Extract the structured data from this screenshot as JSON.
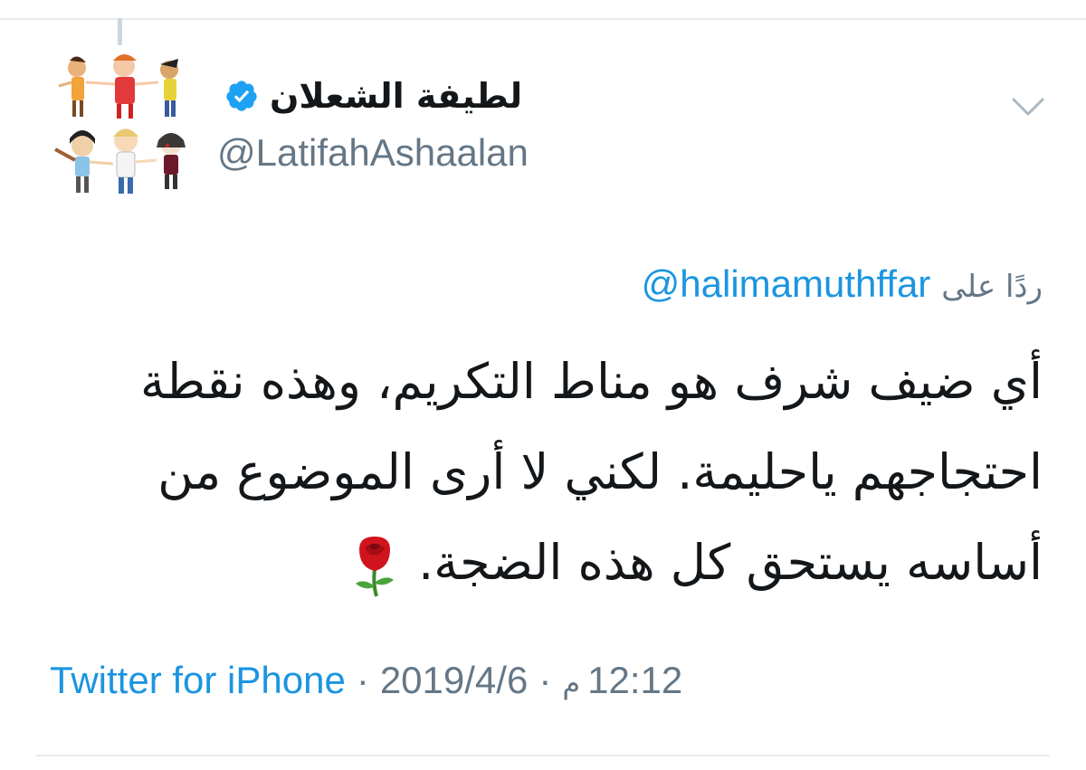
{
  "tweet": {
    "author": {
      "display_name": "لطيفة الشعلان",
      "handle": "@LatifahAshaalan",
      "verified": true
    },
    "reply_prefix": "ردًا على",
    "reply_to": "@halimamuthffar",
    "text": "أي ضيف شرف هو مناط التكريم، وهذه نقطة احتجاجهم ياحليمة. لكني لا أرى الموضوع من أساسه يستحق كل هذه الضجة.",
    "emoji": "rose",
    "time": "12:12",
    "time_suffix": "م",
    "date": "2019/4/6",
    "separator": "·",
    "source": "Twitter for iPhone"
  },
  "icons": {
    "caret": "chevron-down-icon",
    "verified": "verified-badge-icon",
    "rose": "rose-emoji-icon"
  },
  "colors": {
    "link": "#1b95e0",
    "muted": "#657786",
    "text": "#14171a",
    "verified": "#1da1f2",
    "divider": "#e6ecf0"
  }
}
